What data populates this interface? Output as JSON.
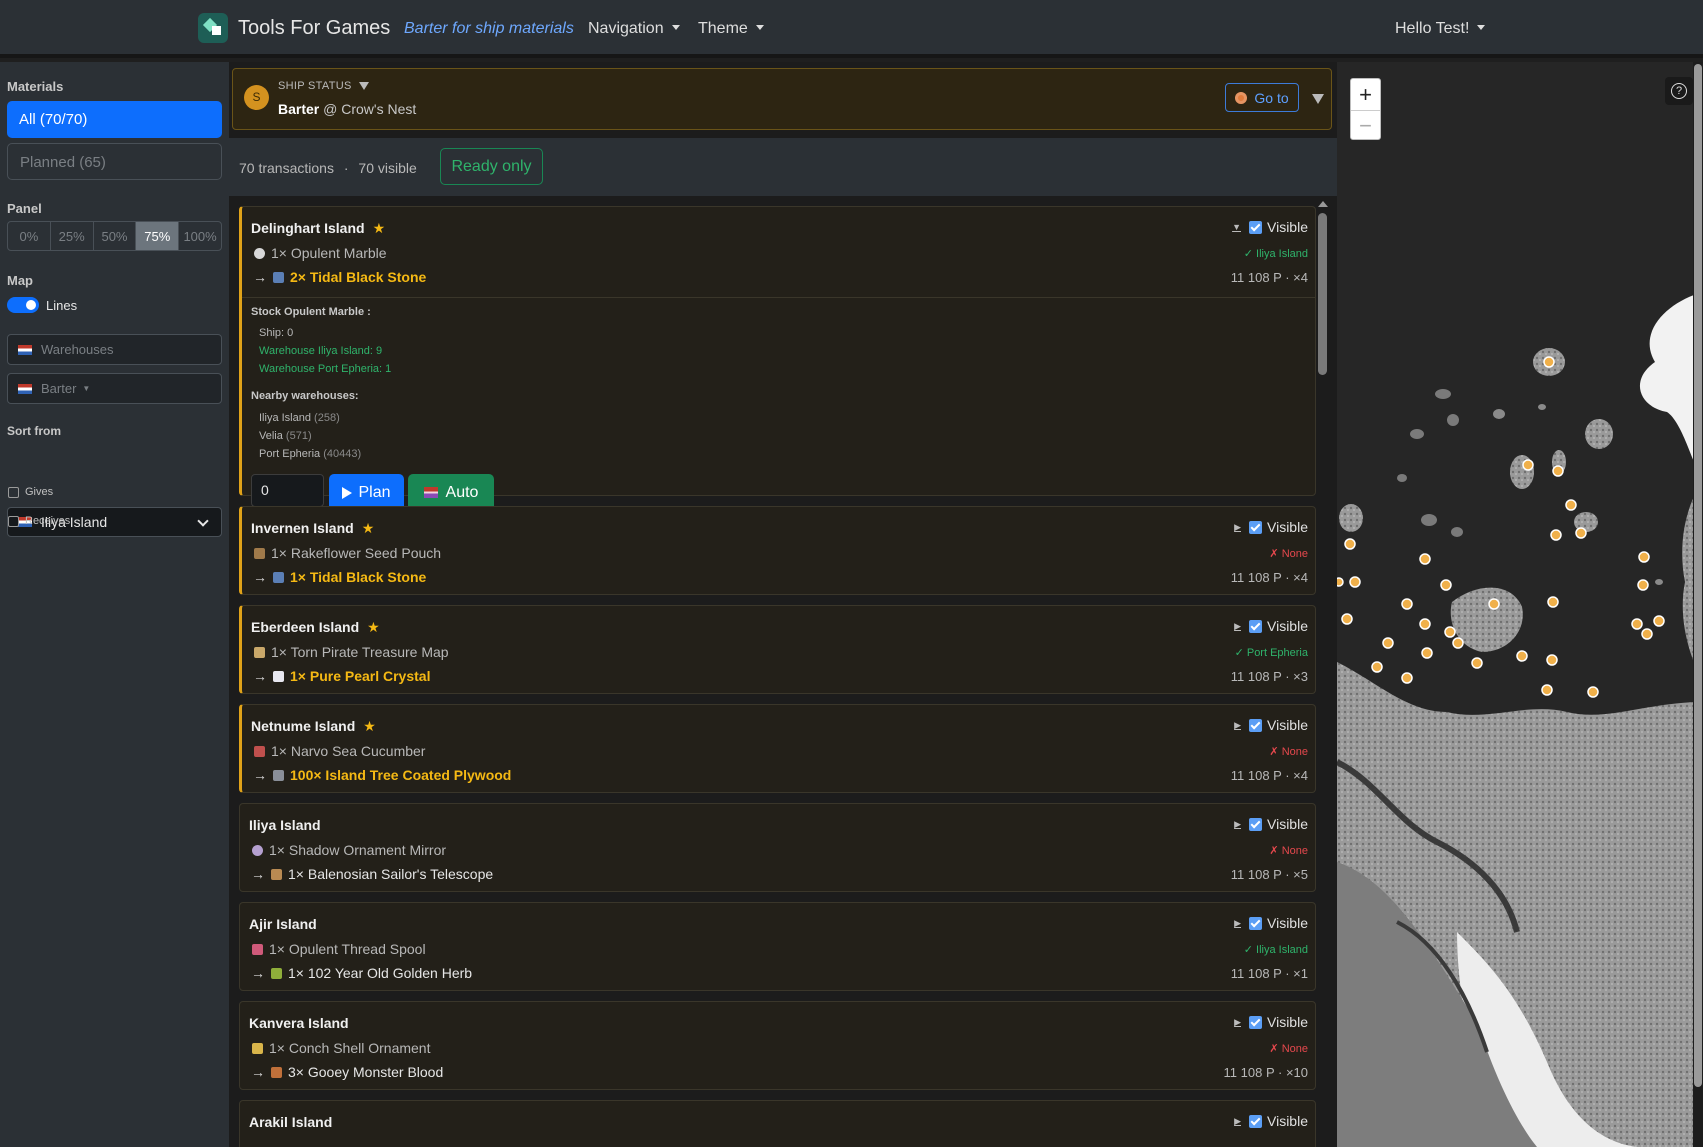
{
  "navbar": {
    "brand": "Tools For Games",
    "active_link": "Barter for ship materials",
    "navigation": "Navigation",
    "theme": "Theme",
    "user": "Hello Test!"
  },
  "sidebar": {
    "materials_label": "Materials",
    "all_btn": "All (70/70)",
    "planned_btn": "Planned (65)",
    "panel_label": "Panel",
    "panel_options": [
      "0%",
      "25%",
      "50%",
      "75%",
      "100%"
    ],
    "panel_selected": "75%",
    "map_label": "Map",
    "lines_label": "Lines",
    "warehouses_placeholder": "Warehouses",
    "barter_select": "Barter",
    "sort_label": "Sort from",
    "sort_value": "Iliya Island",
    "gives_label": "Gives",
    "receives_label": "Receives"
  },
  "ship_status": {
    "avatar": "S",
    "title": "SHIP STATUS",
    "mode": "Barter",
    "location": "@ Crow's Nest",
    "goto": "Go to"
  },
  "summary": {
    "transactions": "70 transactions",
    "sep": "·",
    "visible": "70 visible",
    "ready_btn": "Ready only"
  },
  "cards": [
    {
      "island": "Delinghart Island",
      "fav": true,
      "give": "1× Opulent Marble",
      "get": "2× Tidal Black Stone",
      "loc": "✓ Iliya Island",
      "loc_ok": true,
      "price": "11 108 P · ×4",
      "visible": "Visible"
    },
    {
      "island": "Invernen Island",
      "fav": true,
      "give": "1× Rakeflower Seed Pouch",
      "get": "1× Tidal Black Stone",
      "loc": "✗ None",
      "loc_ok": false,
      "price": "11 108 P · ×4",
      "visible": "Visible"
    },
    {
      "island": "Eberdeen Island",
      "fav": true,
      "give": "1× Torn Pirate Treasure Map",
      "get": "1× Pure Pearl Crystal",
      "loc": "✓ Port Epheria",
      "loc_ok": true,
      "price": "11 108 P · ×3",
      "visible": "Visible"
    },
    {
      "island": "Netnume Island",
      "fav": true,
      "give": "1× Narvo Sea Cucumber",
      "get": "100× Island Tree Coated Plywood",
      "loc": "✗ None",
      "loc_ok": false,
      "price": "11 108 P · ×4",
      "visible": "Visible"
    },
    {
      "island": "Iliya Island",
      "fav": false,
      "give": "1× Shadow Ornament Mirror",
      "get": "1× Balenosian Sailor's Telescope",
      "loc": "✗ None",
      "loc_ok": false,
      "price": "11 108 P · ×5",
      "visible": "Visible"
    },
    {
      "island": "Ajir Island",
      "fav": false,
      "give": "1× Opulent Thread Spool",
      "get": "1× 102 Year Old Golden Herb",
      "loc": "✓ Iliya Island",
      "loc_ok": true,
      "price": "11 108 P · ×1",
      "visible": "Visible"
    },
    {
      "island": "Kanvera Island",
      "fav": false,
      "give": "1× Conch Shell Ornament",
      "get": "3× Gooey Monster Blood",
      "loc": "✗ None",
      "loc_ok": false,
      "price": "11 108 P · ×10",
      "visible": "Visible"
    },
    {
      "island": "Arakil Island",
      "fav": false,
      "visible": "Visible"
    }
  ],
  "expanded": {
    "stock_title": "Stock Opulent Marble :",
    "ship": "Ship: 0",
    "wh1": "Warehouse Iliya Island: 9",
    "wh2": "Warehouse Port Epheria: 1",
    "nearby_title": "Nearby warehouses:",
    "near1_name": "Iliya Island",
    "near1_val": "(258)",
    "near2_name": "Velia",
    "near2_val": "(571)",
    "near3_name": "Port Epheria",
    "near3_val": "(40443)",
    "qty": "0",
    "plan": "Plan",
    "auto": "Auto"
  },
  "map": {
    "zoom_in": "+",
    "zoom_out": "−",
    "help": "?"
  }
}
